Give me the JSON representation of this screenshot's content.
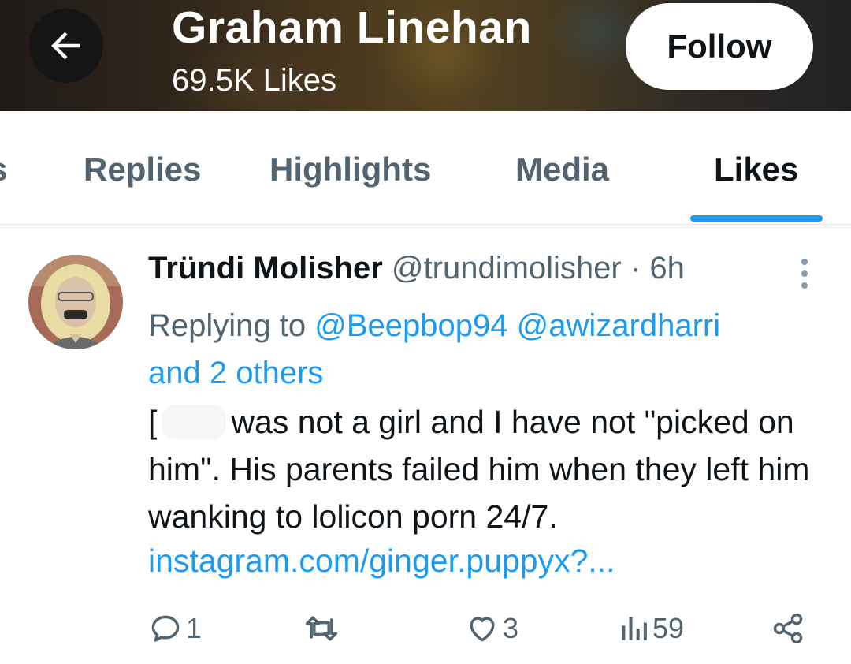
{
  "header": {
    "name": "Graham Linehan",
    "likes_count": "69.5K Likes",
    "follow_label": "Follow"
  },
  "tabs": {
    "cut_fragment": "s",
    "items": [
      {
        "label": "Replies"
      },
      {
        "label": "Highlights"
      },
      {
        "label": "Media"
      },
      {
        "label": "Likes",
        "active": true
      }
    ]
  },
  "post": {
    "author_name": "Tründi Molisher",
    "author_handle": "@trundimolisher",
    "separator": "·",
    "time": "6h",
    "replying_prefix": "Replying to",
    "mention_1": "@Beepbop94",
    "mention_2": "@awizardharri",
    "mention_more": "and 2 others",
    "text_start": "[",
    "text_rest": "was not a girl and I have not \"picked on him\". His parents failed him when they left him wanking to lolicon porn 24/7.",
    "link": "instagram.com/ginger.puppyx?...",
    "reply_count": "1",
    "like_count": "3",
    "view_count": "59"
  },
  "icons": {
    "back": "arrow-left-icon",
    "more": "more-vertical-icon",
    "reply": "reply-bubble-icon",
    "repost": "repost-icon",
    "like": "heart-icon",
    "views": "views-bar-icon",
    "share": "share-icon"
  },
  "colors": {
    "accent": "#1d9bf0",
    "secondary_text": "#536471",
    "primary_text": "#0f1419"
  }
}
